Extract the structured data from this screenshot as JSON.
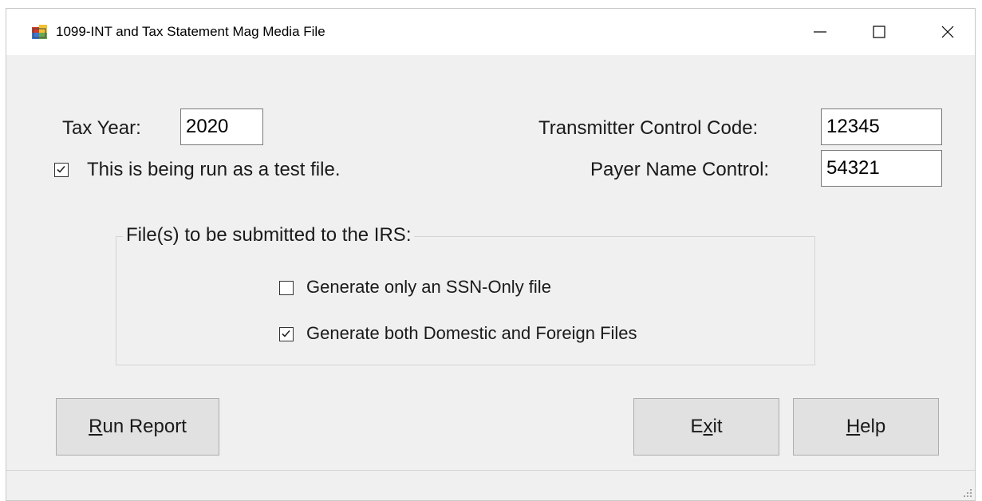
{
  "window": {
    "title": "1099-INT and Tax Statement Mag Media File",
    "icon": "app-form-icon",
    "controls": [
      "minimize-icon",
      "maximize-icon",
      "close-icon"
    ]
  },
  "fields": {
    "tax_year": {
      "label": "Tax Year:",
      "value": "2020"
    },
    "transmitter_control_code": {
      "label": "Transmitter Control Code:",
      "value": "12345"
    },
    "payer_name_control": {
      "label": "Payer Name Control:",
      "value": "54321"
    }
  },
  "test_file": {
    "label": "This is being run as a test file.",
    "checked": true
  },
  "submission": {
    "group_title": "File(s) to be submitted to the IRS:",
    "ssn_only": {
      "label": "Generate only an SSN-Only file",
      "checked": false
    },
    "domestic_foreign": {
      "label": "Generate both Domestic and Foreign Files",
      "checked": true
    }
  },
  "buttons": {
    "run_report": {
      "mnemonic": "R",
      "rest": "un Report"
    },
    "exit": {
      "pre": "E",
      "mnemonic": "x",
      "rest": "it"
    },
    "help": {
      "mnemonic": "H",
      "rest": "elp"
    }
  }
}
